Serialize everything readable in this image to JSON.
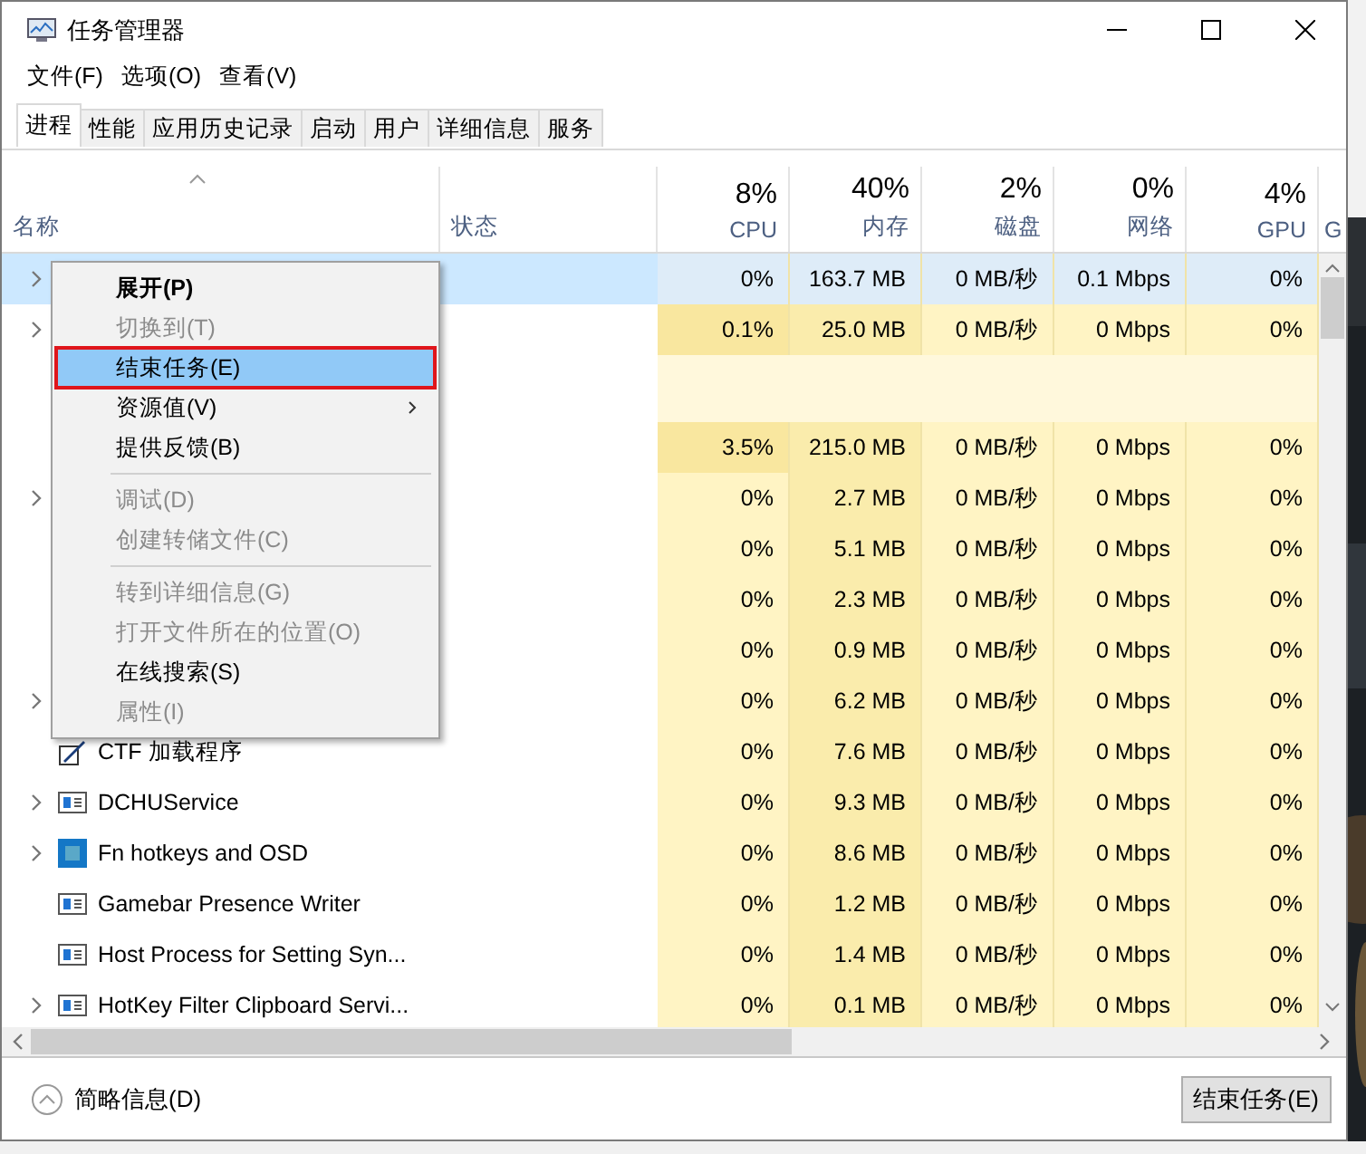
{
  "window": {
    "title": "任务管理器"
  },
  "menu": [
    "文件(F)",
    "选项(O)",
    "查看(V)"
  ],
  "tabs": [
    {
      "label": "进程",
      "selected": true
    },
    {
      "label": "性能",
      "selected": false
    },
    {
      "label": "应用历史记录",
      "selected": false
    },
    {
      "label": "启动",
      "selected": false
    },
    {
      "label": "用户",
      "selected": false
    },
    {
      "label": "详细信息",
      "selected": false
    },
    {
      "label": "服务",
      "selected": false
    }
  ],
  "columns": [
    {
      "label": "名称"
    },
    {
      "label": "状态"
    },
    {
      "percent": "8%",
      "label": "CPU"
    },
    {
      "percent": "40%",
      "label": "内存"
    },
    {
      "percent": "2%",
      "label": "磁盘"
    },
    {
      "percent": "0%",
      "label": "网络"
    },
    {
      "percent": "4%",
      "label": "GPU"
    },
    {
      "label": "G"
    }
  ],
  "rows": [
    {
      "kind": "process",
      "expandable": true,
      "selected": true,
      "cpu_busy": false,
      "cells": [
        "0%",
        "163.7 MB",
        "0 MB/秒",
        "0.1 Mbps",
        "0%"
      ]
    },
    {
      "kind": "process",
      "expandable": true,
      "selected": false,
      "cpu_busy": true,
      "cells": [
        "0.1%",
        "25.0 MB",
        "0 MB/秒",
        "0 Mbps",
        "0%"
      ]
    },
    {
      "kind": "group"
    },
    {
      "kind": "process",
      "selected": false,
      "cpu_busy": true,
      "cells": [
        "3.5%",
        "215.0 MB",
        "0 MB/秒",
        "0 Mbps",
        "0%"
      ]
    },
    {
      "kind": "process",
      "expandable": true,
      "selected": false,
      "cpu_busy": false,
      "cells": [
        "0%",
        "2.7 MB",
        "0 MB/秒",
        "0 Mbps",
        "0%"
      ]
    },
    {
      "kind": "process",
      "selected": false,
      "cpu_busy": false,
      "cells": [
        "0%",
        "5.1 MB",
        "0 MB/秒",
        "0 Mbps",
        "0%"
      ]
    },
    {
      "kind": "process",
      "selected": false,
      "cpu_busy": false,
      "cells": [
        "0%",
        "2.3 MB",
        "0 MB/秒",
        "0 Mbps",
        "0%"
      ]
    },
    {
      "kind": "process",
      "selected": false,
      "cpu_busy": false,
      "cells": [
        "0%",
        "0.9 MB",
        "0 MB/秒",
        "0 Mbps",
        "0%"
      ]
    },
    {
      "kind": "process",
      "expandable": true,
      "selected": false,
      "cpu_busy": false,
      "cells": [
        "0%",
        "6.2 MB",
        "0 MB/秒",
        "0 Mbps",
        "0%"
      ]
    },
    {
      "kind": "pen",
      "selected": false,
      "cpu_busy": false,
      "name": "CTF 加载程序",
      "cells": [
        "0%",
        "7.6 MB",
        "0 MB/秒",
        "0 Mbps",
        "0%"
      ]
    },
    {
      "kind": "window",
      "expandable": true,
      "selected": false,
      "cpu_busy": false,
      "name": "DCHUService",
      "cells": [
        "0%",
        "9.3 MB",
        "0 MB/秒",
        "0 Mbps",
        "0%"
      ]
    },
    {
      "kind": "app",
      "expandable": true,
      "selected": false,
      "cpu_busy": false,
      "name": "Fn hotkeys and OSD",
      "cells": [
        "0%",
        "8.6 MB",
        "0 MB/秒",
        "0 Mbps",
        "0%"
      ]
    },
    {
      "kind": "window",
      "selected": false,
      "cpu_busy": false,
      "name": "Gamebar Presence Writer",
      "cells": [
        "0%",
        "1.2 MB",
        "0 MB/秒",
        "0 Mbps",
        "0%"
      ]
    },
    {
      "kind": "window",
      "selected": false,
      "cpu_busy": false,
      "name": "Host Process for Setting Syn...",
      "cells": [
        "0%",
        "1.4 MB",
        "0 MB/秒",
        "0 Mbps",
        "0%"
      ]
    },
    {
      "kind": "window",
      "expandable": true,
      "selected": false,
      "cpu_busy": false,
      "name": "HotKey Filter Clipboard Servi...",
      "cells": [
        "0%",
        "0.1 MB",
        "0 MB/秒",
        "0 Mbps",
        "0%"
      ]
    }
  ],
  "context_menu": [
    {
      "kind": "item",
      "label": "展开(P)",
      "default": true,
      "disabled": false,
      "selected": false,
      "highlighted": false
    },
    {
      "kind": "item",
      "label": "切换到(T)",
      "default": false,
      "disabled": true,
      "selected": false,
      "highlighted": false
    },
    {
      "kind": "item",
      "label": "结束任务(E)",
      "default": false,
      "disabled": false,
      "selected": true,
      "highlighted": true
    },
    {
      "kind": "submenu",
      "label": "资源值(V)",
      "default": false,
      "disabled": false,
      "selected": false,
      "highlighted": false
    },
    {
      "kind": "item",
      "label": "提供反馈(B)",
      "default": false,
      "disabled": false,
      "selected": false,
      "highlighted": false
    },
    {
      "kind": "separator"
    },
    {
      "kind": "item",
      "label": "调试(D)",
      "default": false,
      "disabled": true,
      "selected": false,
      "highlighted": false
    },
    {
      "kind": "item",
      "label": "创建转储文件(C)",
      "default": false,
      "disabled": true,
      "selected": false,
      "highlighted": false
    },
    {
      "kind": "separator"
    },
    {
      "kind": "item",
      "label": "转到详细信息(G)",
      "default": false,
      "disabled": true,
      "selected": false,
      "highlighted": false
    },
    {
      "kind": "item",
      "label": "打开文件所在的位置(O)",
      "default": false,
      "disabled": true,
      "selected": false,
      "highlighted": false
    },
    {
      "kind": "item",
      "label": "在线搜索(S)",
      "default": false,
      "disabled": false,
      "selected": false,
      "highlighted": false
    },
    {
      "kind": "item",
      "label": "属性(I)",
      "default": false,
      "disabled": true,
      "selected": false,
      "highlighted": false
    }
  ],
  "footer": {
    "details_link": "简略信息(D)",
    "end_task_button": "结束任务(E)"
  }
}
